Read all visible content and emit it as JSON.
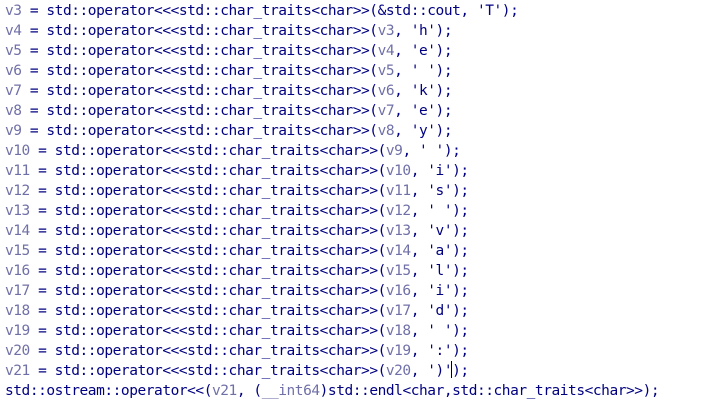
{
  "editor": {
    "lines": [
      [
        {
          "t": "v3",
          "k": "var"
        },
        {
          "t": " = std::operator<<<std::char_traits<char>>(&std::cout, 'T');",
          "k": "plain"
        }
      ],
      [
        {
          "t": "v4",
          "k": "var"
        },
        {
          "t": " = std::operator<<<std::char_traits<char>>(",
          "k": "plain"
        },
        {
          "t": "v3",
          "k": "var"
        },
        {
          "t": ", 'h');",
          "k": "plain"
        }
      ],
      [
        {
          "t": "v5",
          "k": "var"
        },
        {
          "t": " = std::operator<<<std::char_traits<char>>(",
          "k": "plain"
        },
        {
          "t": "v4",
          "k": "var"
        },
        {
          "t": ", 'e');",
          "k": "plain"
        }
      ],
      [
        {
          "t": "v6",
          "k": "var"
        },
        {
          "t": " = std::operator<<<std::char_traits<char>>(",
          "k": "plain"
        },
        {
          "t": "v5",
          "k": "var"
        },
        {
          "t": ", ' ');",
          "k": "plain"
        }
      ],
      [
        {
          "t": "v7",
          "k": "var"
        },
        {
          "t": " = std::operator<<<std::char_traits<char>>(",
          "k": "plain"
        },
        {
          "t": "v6",
          "k": "var"
        },
        {
          "t": ", 'k');",
          "k": "plain"
        }
      ],
      [
        {
          "t": "v8",
          "k": "var"
        },
        {
          "t": " = std::operator<<<std::char_traits<char>>(",
          "k": "plain"
        },
        {
          "t": "v7",
          "k": "var"
        },
        {
          "t": ", 'e');",
          "k": "plain"
        }
      ],
      [
        {
          "t": "v9",
          "k": "var"
        },
        {
          "t": " = std::operator<<<std::char_traits<char>>(",
          "k": "plain"
        },
        {
          "t": "v8",
          "k": "var"
        },
        {
          "t": ", 'y');",
          "k": "plain"
        }
      ],
      [
        {
          "t": "v10",
          "k": "var"
        },
        {
          "t": " = std::operator<<<std::char_traits<char>>(",
          "k": "plain"
        },
        {
          "t": "v9",
          "k": "var"
        },
        {
          "t": ", ' ');",
          "k": "plain"
        }
      ],
      [
        {
          "t": "v11",
          "k": "var"
        },
        {
          "t": " = std::operator<<<std::char_traits<char>>(",
          "k": "plain"
        },
        {
          "t": "v10",
          "k": "var"
        },
        {
          "t": ", 'i');",
          "k": "plain"
        }
      ],
      [
        {
          "t": "v12",
          "k": "var"
        },
        {
          "t": " = std::operator<<<std::char_traits<char>>(",
          "k": "plain"
        },
        {
          "t": "v11",
          "k": "var"
        },
        {
          "t": ", 's');",
          "k": "plain"
        }
      ],
      [
        {
          "t": "v13",
          "k": "var"
        },
        {
          "t": " = std::operator<<<std::char_traits<char>>(",
          "k": "plain"
        },
        {
          "t": "v12",
          "k": "var"
        },
        {
          "t": ", ' ');",
          "k": "plain"
        }
      ],
      [
        {
          "t": "v14",
          "k": "var"
        },
        {
          "t": " = std::operator<<<std::char_traits<char>>(",
          "k": "plain"
        },
        {
          "t": "v13",
          "k": "var"
        },
        {
          "t": ", 'v');",
          "k": "plain"
        }
      ],
      [
        {
          "t": "v15",
          "k": "var"
        },
        {
          "t": " = std::operator<<<std::char_traits<char>>(",
          "k": "plain"
        },
        {
          "t": "v14",
          "k": "var"
        },
        {
          "t": ", 'a');",
          "k": "plain"
        }
      ],
      [
        {
          "t": "v16",
          "k": "var"
        },
        {
          "t": " = std::operator<<<std::char_traits<char>>(",
          "k": "plain"
        },
        {
          "t": "v15",
          "k": "var"
        },
        {
          "t": ", 'l');",
          "k": "plain"
        }
      ],
      [
        {
          "t": "v17",
          "k": "var"
        },
        {
          "t": " = std::operator<<<std::char_traits<char>>(",
          "k": "plain"
        },
        {
          "t": "v16",
          "k": "var"
        },
        {
          "t": ", 'i');",
          "k": "plain"
        }
      ],
      [
        {
          "t": "v18",
          "k": "var"
        },
        {
          "t": " = std::operator<<<std::char_traits<char>>(",
          "k": "plain"
        },
        {
          "t": "v17",
          "k": "var"
        },
        {
          "t": ", 'd');",
          "k": "plain"
        }
      ],
      [
        {
          "t": "v19",
          "k": "var"
        },
        {
          "t": " = std::operator<<<std::char_traits<char>>(",
          "k": "plain"
        },
        {
          "t": "v18",
          "k": "var"
        },
        {
          "t": ", ' ');",
          "k": "plain"
        }
      ],
      [
        {
          "t": "v20",
          "k": "var"
        },
        {
          "t": " = std::operator<<<std::char_traits<char>>(",
          "k": "plain"
        },
        {
          "t": "v19",
          "k": "var"
        },
        {
          "t": ", ':');",
          "k": "plain"
        }
      ],
      [
        {
          "t": "v21",
          "k": "var"
        },
        {
          "t": " = std::operator<<<std::char_traits<char>>(",
          "k": "plain"
        },
        {
          "t": "v20",
          "k": "var"
        },
        {
          "t": ", ')'",
          "k": "plain"
        },
        {
          "t": "",
          "k": "caret"
        },
        {
          "t": ");",
          "k": "plain"
        }
      ],
      [
        {
          "t": "std::ostream::operator<<(",
          "k": "plain"
        },
        {
          "t": "v21",
          "k": "var"
        },
        {
          "t": ", (",
          "k": "plain"
        },
        {
          "t": "__int64",
          "k": "var"
        },
        {
          "t": ")std::endl<char,std::char_traits<char>>);",
          "k": "plain"
        }
      ]
    ]
  },
  "colors": {
    "background": "#ffffff",
    "code_text": "#000080",
    "variable": "#7070a8",
    "caret": "#000000"
  }
}
